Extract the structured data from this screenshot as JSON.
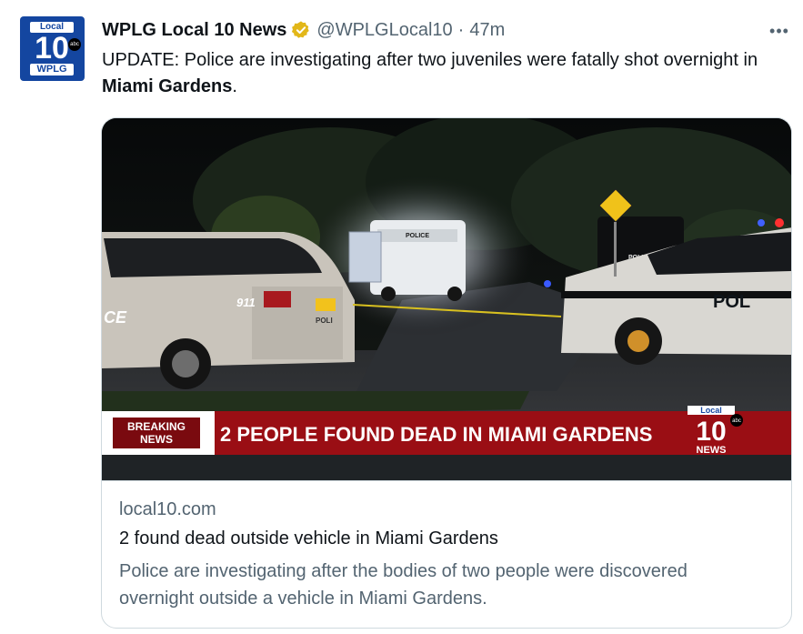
{
  "account": {
    "display_name": "WPLG Local 10 News",
    "handle": "@WPLGLocal10",
    "separator": "·",
    "timestamp": "47m",
    "avatar": {
      "top_text": "Local",
      "number": "10",
      "network": "abc",
      "bottom_text": "WPLG"
    },
    "verified_icon": "verified-gold-badge-icon"
  },
  "more_menu": {
    "label": "•••",
    "icon": "more-options-icon"
  },
  "tweet": {
    "text_before": "UPDATE: Police are investigating after two juveniles were fatally shot overnight in ",
    "text_bold": "Miami Gardens",
    "text_after": "."
  },
  "card": {
    "image": {
      "breaking_line1": "BREAKING",
      "breaking_line2": "NEWS",
      "headline": "2 PEOPLE FOUND DEAD IN MIAMI GARDENS",
      "logo_top": "Local",
      "logo_number": "10",
      "logo_network": "abc",
      "logo_bottom": "NEWS",
      "van_text": "POLICE",
      "suv_text": "POLICE",
      "car_text": "POL",
      "car_unit": "911",
      "car_side": "POLI",
      "left_car_text": "CE"
    },
    "domain": "local10.com",
    "title": "2 found dead outside vehicle in Miami Gardens",
    "description": "Police are investigating after the bodies of two people were discovered overnight outside a vehicle in Miami Gardens."
  },
  "colors": {
    "text_primary": "#0f1419",
    "text_secondary": "#536471",
    "border": "#cfd9de",
    "brand_blue": "#1446a0",
    "breaking_red": "#9a0e14",
    "verified_gold": "#e2b719"
  }
}
